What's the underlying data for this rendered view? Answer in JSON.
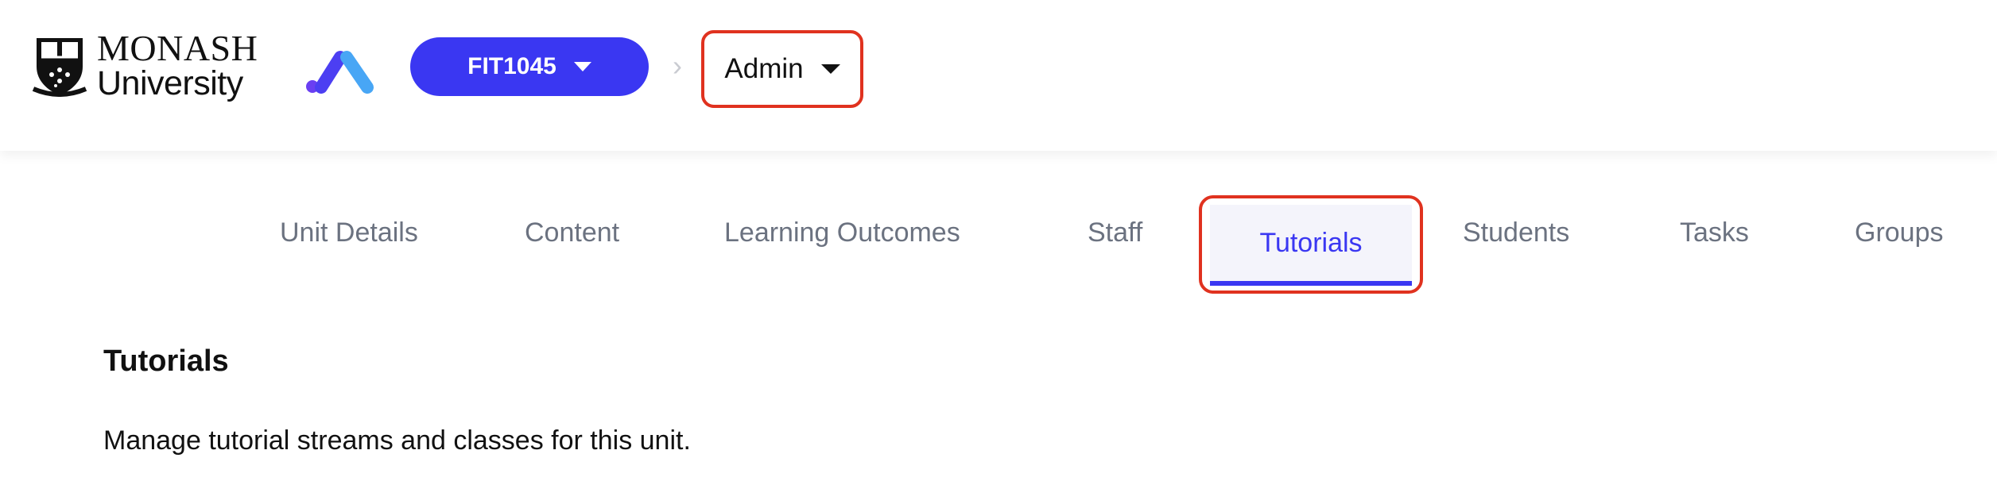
{
  "header": {
    "logo": {
      "line1": "MONASH",
      "line2": "University"
    },
    "unit_selector": {
      "label": "FIT1045"
    },
    "breadcrumb_separator": "›",
    "role_selector": {
      "label": "Admin"
    }
  },
  "tabs": [
    {
      "label": "Unit Details"
    },
    {
      "label": "Content"
    },
    {
      "label": "Learning Outcomes"
    },
    {
      "label": "Staff"
    },
    {
      "label": "Tutorials",
      "active": true
    },
    {
      "label": "Students"
    },
    {
      "label": "Tasks"
    },
    {
      "label": "Groups"
    }
  ],
  "main": {
    "title": "Tutorials",
    "description": "Manage tutorial streams and classes for this unit."
  },
  "colors": {
    "accent": "#3a37f2",
    "highlight_outline": "#e0321f",
    "tab_inactive": "#6b7280"
  }
}
